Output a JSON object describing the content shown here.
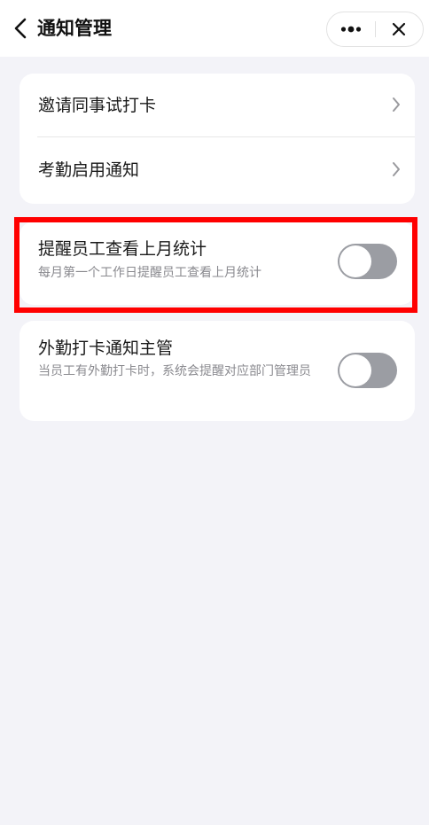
{
  "header": {
    "title": "通知管理",
    "back_icon": "chevron-left-icon",
    "more_icon": "more-dots-icon",
    "close_icon": "close-icon"
  },
  "nav_items": [
    {
      "label": "邀请同事试打卡",
      "icon": "chevron-right-icon"
    },
    {
      "label": "考勤启用通知",
      "icon": "chevron-right-icon"
    }
  ],
  "toggles": [
    {
      "title": "提醒员工查看上月统计",
      "description": "每月第一个工作日提醒员工查看上月统计",
      "enabled": false,
      "highlighted": true
    },
    {
      "title": "外勤打卡通知主管",
      "description": "当员工有外勤打卡时，系统会提醒对应部门管理员",
      "enabled": false,
      "highlighted": false
    }
  ],
  "colors": {
    "background": "#f3f3f8",
    "card": "#ffffff",
    "toggle_off": "#9b9da3",
    "highlight_border": "#ff0000",
    "secondary_text": "#8a8a8f"
  }
}
